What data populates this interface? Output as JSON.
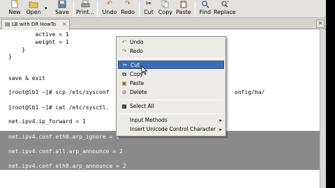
{
  "toolbar": {
    "new": "New",
    "open": "Open",
    "save": "Save",
    "print": "Print...",
    "undo": "Undo",
    "redo": "Redo",
    "cut": "Cut",
    "copy": "Copy",
    "paste": "Paste",
    "find": "Find",
    "replace": "Replace"
  },
  "tab": {
    "label": "LB with DR HowTo",
    "close": "×"
  },
  "editor": {
    "lines": [
      "        active = 1",
      "        weight = 1",
      "    }",
      "}",
      "",
      "save & exit",
      "",
      "[root@lb1 ~]# scp /etc/sysconf",
      "onfig/ha/",
      "",
      "[root@lb1 ~]# cat /etc/sysctl.",
      "",
      "net.ipv4.ip_forward = 1",
      "",
      "net.ipv4.conf.eth0.arp_ignore = 1",
      "",
      "net.ipv4.conf.all.arp_announce = 2",
      "",
      "net.ipv4.conf.eth0.arp_announce = 2"
    ]
  },
  "context_menu": {
    "undo": "Undo",
    "redo": "Redo",
    "cut": "Cut",
    "copy": "Copy",
    "paste": "Paste",
    "delete": "Delete",
    "select_all": "Select All",
    "input_methods": "Input Methods",
    "insert_unicode": "Insert Unicode Control Character"
  },
  "colors": {
    "selection": "#8a8a8a",
    "menu_highlight": "#3d6cb3"
  }
}
